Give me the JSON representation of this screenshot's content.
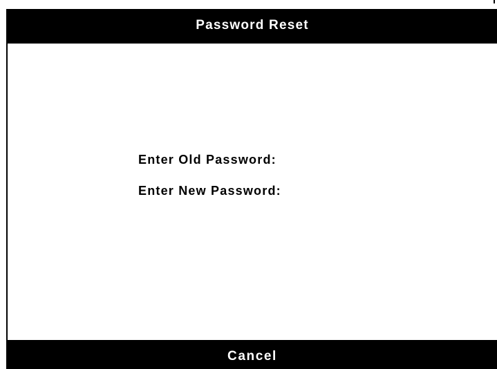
{
  "dialog": {
    "title": "Password Reset"
  },
  "form": {
    "old_password_label": "Enter Old Password:",
    "new_password_label": "Enter New Password:"
  },
  "footer": {
    "cancel_label": "Cancel"
  },
  "colors": {
    "bar_background": "#000000",
    "bar_text": "#ffffff",
    "body_background": "#ffffff",
    "body_text": "#000000"
  }
}
